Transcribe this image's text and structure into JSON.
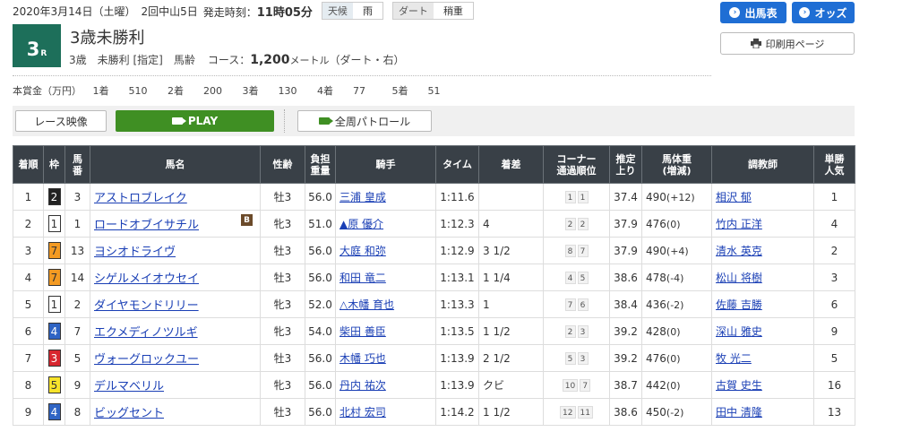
{
  "header": {
    "date": "2020年3月14日（土曜）",
    "meeting": "2回中山5日",
    "start_label": "発走時刻：",
    "start_time": "11時05分",
    "weather_label": "天候",
    "weather_value": "雨",
    "track_label": "ダート",
    "track_value": "稍重"
  },
  "race": {
    "number": "3",
    "number_suffix": "R",
    "title": "3歳未勝利",
    "class_text": "3歳　未勝利 [指定]　馬齢",
    "course_label": "コース：",
    "distance": "1,200",
    "distance_unit": "メートル",
    "course_detail": "（ダート・右）"
  },
  "prize": {
    "label": "本賞金（万円）",
    "items": [
      {
        "place": "1着",
        "amount": "510"
      },
      {
        "place": "2着",
        "amount": "200"
      },
      {
        "place": "3着",
        "amount": "130"
      },
      {
        "place": "4着",
        "amount": "77"
      },
      {
        "place": "5着",
        "amount": "51"
      }
    ]
  },
  "buttons": {
    "shutsuba": "出馬表",
    "odds": "オッズ",
    "print": "印刷用ページ",
    "race_video": "レース映像",
    "play": "PLAY",
    "patrol": "全周パトロール"
  },
  "colors": {
    "race_badge": "#1d6f5a",
    "blue_button": "#1f6ed4",
    "play_button": "#3f8f23",
    "table_header": "#394047",
    "link": "#1a3fb5"
  },
  "table": {
    "headers": [
      "着順",
      "枠",
      "馬番",
      "馬名",
      "性齢",
      "負担重量",
      "騎手",
      "タイム",
      "着差",
      "コーナー通過順位",
      "推定上り",
      "馬体重(増減)",
      "調教師",
      "単勝人気"
    ],
    "rows": [
      {
        "rank": "1",
        "waku": "2",
        "num": "3",
        "horse": "アストロブレイク",
        "blinker": "",
        "sex": "牡3",
        "weight": "56.0",
        "jockey": "三浦 皇成",
        "time": "1:11.6",
        "margin": "",
        "c1": "1",
        "c2": "1",
        "last3f": "37.4",
        "body": "490",
        "diff": "(+12)",
        "trainer": "相沢 郁",
        "pop": "1"
      },
      {
        "rank": "2",
        "waku": "1",
        "num": "1",
        "horse": "ロードオブイサチル",
        "blinker": "B",
        "sex": "牝3",
        "weight": "51.0",
        "jockey": "▲原 優介",
        "time": "1:12.3",
        "margin": "4",
        "c1": "2",
        "c2": "2",
        "last3f": "37.9",
        "body": "476",
        "diff": "(0)",
        "trainer": "竹内 正洋",
        "pop": "4"
      },
      {
        "rank": "3",
        "waku": "7",
        "num": "13",
        "horse": "ヨシオドライヴ",
        "blinker": "",
        "sex": "牡3",
        "weight": "56.0",
        "jockey": "大庭 和弥",
        "time": "1:12.9",
        "margin": "3 1/2",
        "c1": "8",
        "c2": "7",
        "last3f": "37.9",
        "body": "490",
        "diff": "(+4)",
        "trainer": "清水 英克",
        "pop": "2"
      },
      {
        "rank": "4",
        "waku": "7",
        "num": "14",
        "horse": "シゲルメイオウセイ",
        "blinker": "",
        "sex": "牡3",
        "weight": "56.0",
        "jockey": "和田 竜二",
        "time": "1:13.1",
        "margin": "1 1/4",
        "c1": "4",
        "c2": "5",
        "last3f": "38.6",
        "body": "478",
        "diff": "(-4)",
        "trainer": "松山 将樹",
        "pop": "3"
      },
      {
        "rank": "5",
        "waku": "1",
        "num": "2",
        "horse": "ダイヤモンドリリー",
        "blinker": "",
        "sex": "牝3",
        "weight": "52.0",
        "jockey": "△木幡 育也",
        "time": "1:13.3",
        "margin": "1",
        "c1": "7",
        "c2": "6",
        "last3f": "38.4",
        "body": "436",
        "diff": "(-2)",
        "trainer": "佐藤 吉勝",
        "pop": "6"
      },
      {
        "rank": "6",
        "waku": "4",
        "num": "7",
        "horse": "エクメディノツルギ",
        "blinker": "",
        "sex": "牝3",
        "weight": "54.0",
        "jockey": "柴田 善臣",
        "time": "1:13.5",
        "margin": "1 1/2",
        "c1": "2",
        "c2": "3",
        "last3f": "39.2",
        "body": "428",
        "diff": "(0)",
        "trainer": "深山 雅史",
        "pop": "9"
      },
      {
        "rank": "7",
        "waku": "3",
        "num": "5",
        "horse": "ヴォーグロックユー",
        "blinker": "",
        "sex": "牡3",
        "weight": "56.0",
        "jockey": "木幡 巧也",
        "time": "1:13.9",
        "margin": "2 1/2",
        "c1": "5",
        "c2": "3",
        "last3f": "39.2",
        "body": "476",
        "diff": "(0)",
        "trainer": "牧 光二",
        "pop": "5"
      },
      {
        "rank": "8",
        "waku": "5",
        "num": "9",
        "horse": "デルマベリル",
        "blinker": "",
        "sex": "牝3",
        "weight": "56.0",
        "jockey": "丹内 祐次",
        "time": "1:13.9",
        "margin": "クビ",
        "c1": "10",
        "c2": "7",
        "last3f": "38.7",
        "body": "442",
        "diff": "(0)",
        "trainer": "古賀 史生",
        "pop": "16"
      },
      {
        "rank": "9",
        "waku": "4",
        "num": "8",
        "horse": "ビッグセント",
        "blinker": "",
        "sex": "牡3",
        "weight": "56.0",
        "jockey": "北村 宏司",
        "time": "1:14.2",
        "margin": "1 1/2",
        "c1": "12",
        "c2": "11",
        "last3f": "38.6",
        "body": "450",
        "diff": "(-2)",
        "trainer": "田中 清隆",
        "pop": "13"
      }
    ]
  },
  "waku_colors": {
    "1": {
      "bg": "#ffffff",
      "fg": "#333333"
    },
    "2": {
      "bg": "#222222",
      "fg": "#ffffff"
    },
    "3": {
      "bg": "#d8262f",
      "fg": "#ffffff"
    },
    "4": {
      "bg": "#2f64c4",
      "fg": "#ffffff"
    },
    "5": {
      "bg": "#f7e32b",
      "fg": "#333333"
    },
    "7": {
      "bg": "#f39a22",
      "fg": "#333333"
    }
  }
}
